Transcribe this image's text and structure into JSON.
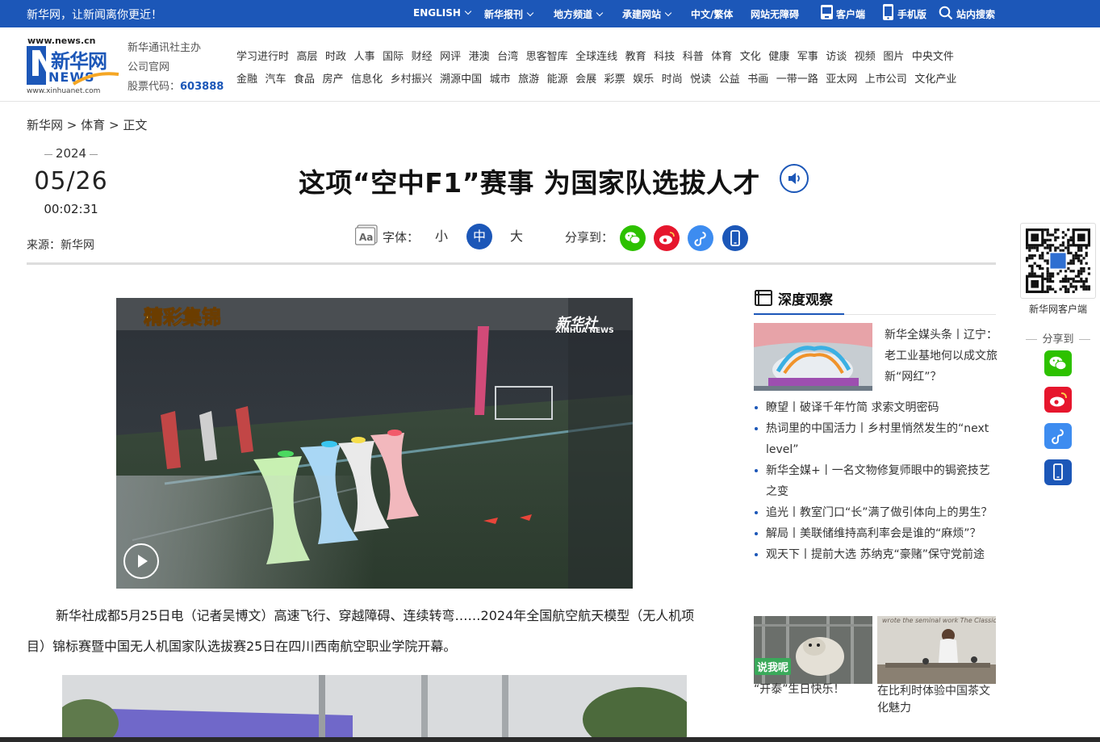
{
  "topbar": {
    "slogan": "新华网，让新闻离你更近！",
    "items": [
      "ENGLISH",
      "新华报刊",
      "地方频道",
      "承建网站",
      "中文/繁体",
      "网站无障碍",
      "客户端",
      "手机版",
      "站内搜索"
    ]
  },
  "header": {
    "logo_top": "www.news.cn",
    "logo_main": "新华网",
    "logo_news": "NEWS",
    "logo_bottom": "www.xinhuanet.com",
    "org_line1": "新华通讯社主办",
    "org_line2": "公司官网",
    "stock_label": "股票代码：",
    "stock_code": "603888",
    "nav_row1": [
      "学习进行时",
      "高层",
      "时政",
      "人事",
      "国际",
      "财经",
      "网评",
      "港澳",
      "台湾",
      "思客智库",
      "全球连线",
      "教育",
      "科技",
      "科普",
      "体育",
      "文化",
      "健康",
      "军事",
      "访谈",
      "视频",
      "图片",
      "中央文件"
    ],
    "nav_row2": [
      "金融",
      "汽车",
      "食品",
      "房产",
      "信息化",
      "乡村振兴",
      "溯源中国",
      "城市",
      "旅游",
      "能源",
      "会展",
      "彩票",
      "娱乐",
      "时尚",
      "悦读",
      "公益",
      "书画",
      "一带一路",
      "亚太网",
      "上市公司",
      "文化产业"
    ]
  },
  "breadcrumb": {
    "home": "新华网",
    "sep": ">",
    "section": "体育",
    "current": "正文"
  },
  "meta": {
    "year": "2024",
    "month_day": "05/26",
    "time": "00:02:31",
    "source": "来源：新华网"
  },
  "article": {
    "title": "这项“空中F1”赛事 为国家队选拔人才",
    "font_label": "字体：",
    "font_sizes": [
      "小",
      "中",
      "大"
    ],
    "share_label": "分享到：",
    "video_caption": "精彩集锦",
    "video_logo": "新华社",
    "video_logo_en": "XINHUA NEWS",
    "paragraph": "新华社成都5月25日电（记者吴博文）高速飞行、穿越障碍、连续转弯……2024年全国航空航天模型（无人机项目）锦标赛暨中国无人机国家队选拔赛25日在四川西南航空职业学院开幕。"
  },
  "sidebar": {
    "section_title": "深度观察",
    "feature_title": "新华全媒头条丨辽宁：老工业基地何以成文旅新“网红”？",
    "news": [
      "瞭望丨破译千年竹简 求索文明密码",
      "热词里的中国活力丨乡村里悄然发生的“next level”",
      "新华全媒+丨一名文物修复师眼中的锔瓷技艺之变",
      "追光丨教室门口“长”满了做引体向上的男生？",
      "解局丨美联储维持高利率会是谁的“麻烦”？",
      "观天下丨提前大选 苏纳克“豪赌”保守党前途"
    ],
    "thumb1_badge": "说我呢",
    "thumb1_caption": "“开泰”生日快乐！",
    "thumb2_overlay": "wrote the seminal work The Classic of Te",
    "thumb2_caption": "在比利时体验中国茶文化魅力"
  },
  "float_panel": {
    "qr_label": "新华网客户端",
    "share_label": "分享到"
  },
  "colors": {
    "brand": "#1c57b8",
    "wechat": "#2dc100",
    "weibo": "#e6162d",
    "link": "#3d8cf0"
  }
}
